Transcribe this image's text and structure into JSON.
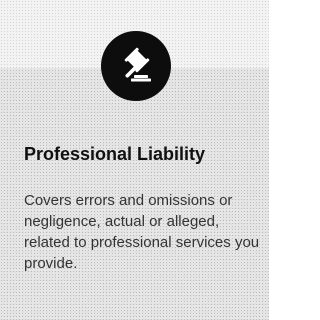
{
  "card": {
    "icon": "gavel-icon",
    "title": "Professional Liability",
    "description": "Covers errors and omissions or negligence, actual or alleged, related to professional services you provide."
  },
  "colors": {
    "background": "#e7e7e7",
    "badge": "#0d0d0d",
    "icon": "#ffffff",
    "title": "#111111",
    "text": "#333333"
  }
}
